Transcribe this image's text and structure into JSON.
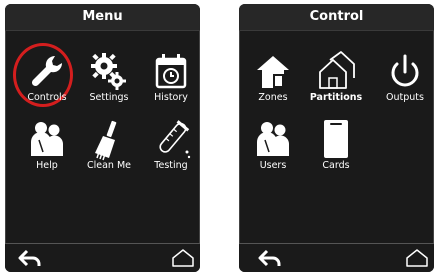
{
  "menu": {
    "title": "Menu",
    "tiles": [
      {
        "label": "Controls",
        "icon": "wrench-icon"
      },
      {
        "label": "Settings",
        "icon": "gears-icon"
      },
      {
        "label": "History",
        "icon": "calendar-history-icon"
      },
      {
        "label": "Help",
        "icon": "people-help-icon"
      },
      {
        "label": "Clean Me",
        "icon": "brush-clean-icon"
      },
      {
        "label": "Testing",
        "icon": "test-tube-icon"
      }
    ],
    "highlight_color": "#d41e1e"
  },
  "control": {
    "title": "Control",
    "tiles": [
      {
        "label": "Zones",
        "icon": "zones-house-icon"
      },
      {
        "label": "Partitions",
        "icon": "partitions-house-icon"
      },
      {
        "label": "Outputs",
        "icon": "power-icon"
      },
      {
        "label": "Users",
        "icon": "users-icon"
      },
      {
        "label": "Cards",
        "icon": "card-icon"
      }
    ]
  },
  "navigation": {
    "back_icon": "back-arrow-icon",
    "home_icon": "home-icon"
  }
}
